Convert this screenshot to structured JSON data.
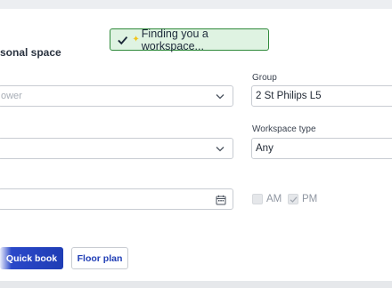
{
  "toast": {
    "message": "Finding you a workspace...",
    "icon": "check-icon",
    "accent": "#2f8a3b"
  },
  "section": {
    "title": "sonal space"
  },
  "left_form": {
    "building_value": "ower",
    "floor_value": "",
    "date_value": ""
  },
  "right_form": {
    "group_label": "Group",
    "group_value": "2 St Philips L5",
    "workspace_type_label": "Workspace type",
    "workspace_type_value": "Any"
  },
  "time_options": [
    {
      "label": "AM",
      "checked": false
    },
    {
      "label": "PM",
      "checked": true
    }
  ],
  "actions": {
    "quick_book_label": "Quick book",
    "floor_plan_label": "Floor plan",
    "primary_color": "#1f3db5"
  }
}
